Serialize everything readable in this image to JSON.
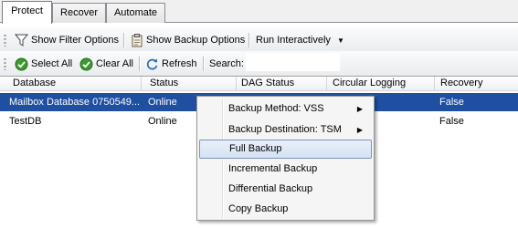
{
  "tabs": [
    {
      "label": "Protect",
      "active": true
    },
    {
      "label": "Recover",
      "active": false
    },
    {
      "label": "Automate",
      "active": false
    }
  ],
  "toolbar1": {
    "show_filter": "Show Filter Options",
    "show_backup": "Show Backup Options",
    "run_interactively": "Run Interactively"
  },
  "toolbar2": {
    "select_all": "Select All",
    "clear_all": "Clear All",
    "refresh": "Refresh",
    "search_label": "Search:",
    "search_value": ""
  },
  "grid": {
    "columns": [
      "Database",
      "Status",
      "DAG Status",
      "Circular Logging",
      "Recovery"
    ],
    "rows": [
      {
        "database": "Mailbox Database 0750549...",
        "status": "Online",
        "dag_status": "",
        "circular_logging": "",
        "recovery": "False",
        "selected": true
      },
      {
        "database": "TestDB",
        "status": "Online",
        "dag_status": "",
        "circular_logging": "",
        "recovery": "False",
        "selected": false
      }
    ]
  },
  "context_menu": {
    "items": [
      {
        "label": "Backup Method: VSS",
        "submenu": true
      },
      {
        "label": "Backup Destination: TSM",
        "submenu": true
      },
      {
        "label": "Full Backup",
        "submenu": false,
        "highlighted": true
      },
      {
        "label": "Incremental Backup",
        "submenu": false
      },
      {
        "label": "Differential Backup",
        "submenu": false
      },
      {
        "label": "Copy Backup",
        "submenu": false
      }
    ]
  },
  "colors": {
    "selection": "#1e4fa0",
    "menu_highlight_border": "#7c93b9",
    "check_green": "#3a9a2e"
  }
}
